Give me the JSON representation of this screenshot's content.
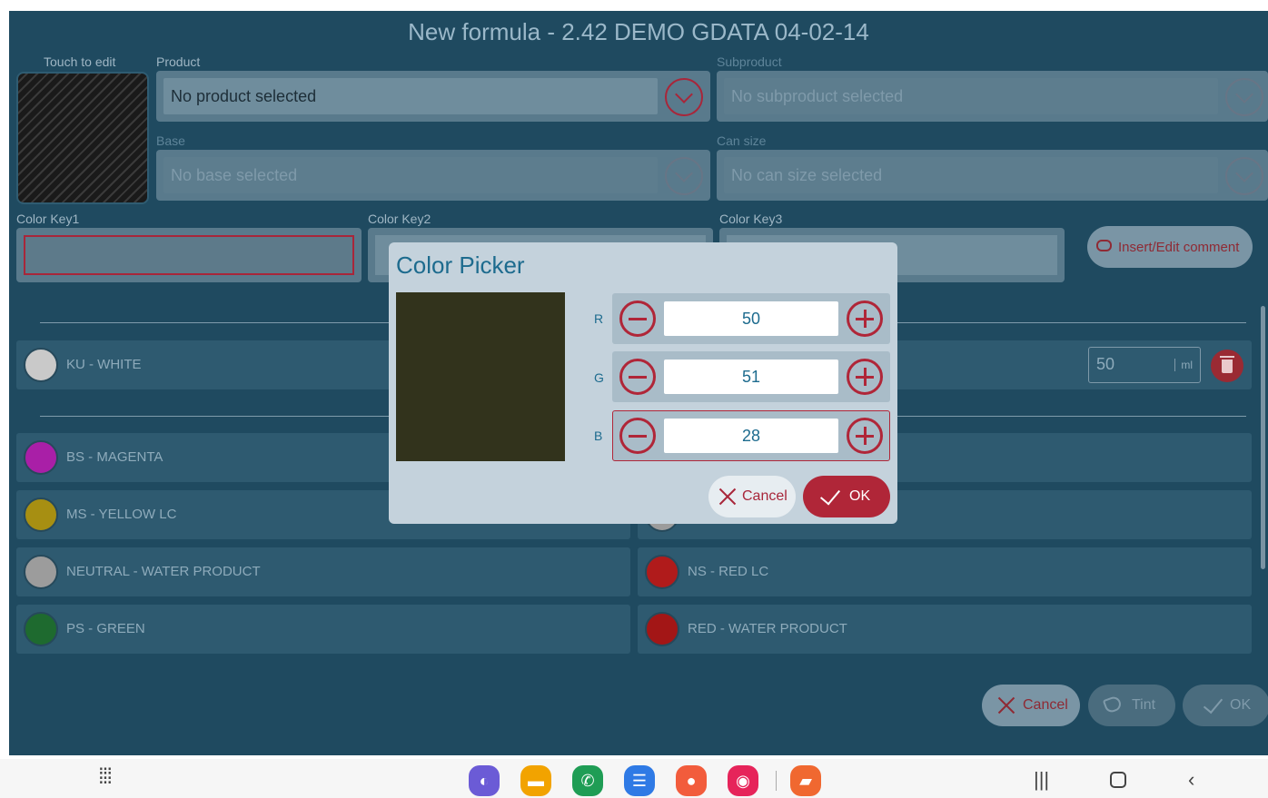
{
  "header": {
    "title": "New formula - 2.42  DEMO GDATA 04-02-14"
  },
  "swatch": {
    "label": "Touch to edit"
  },
  "fields": {
    "product": {
      "label": "Product",
      "value": "No product selected"
    },
    "subproduct": {
      "label": "Subproduct",
      "value": "No subproduct selected"
    },
    "base": {
      "label": "Base",
      "value": "No base selected"
    },
    "can_size": {
      "label": "Can size",
      "value": "No can size selected"
    }
  },
  "color_keys": {
    "key1": "Color Key1",
    "key2": "Color Key2",
    "key3": "Color Key3"
  },
  "comment_button": "Insert/Edit comment",
  "colorants": [
    {
      "name": "KU - WHITE",
      "color": "#c9c9c9"
    },
    {
      "name": "BS - MAGENTA",
      "color": "#a91fa7"
    },
    {
      "name": "MS - YELLOW LC",
      "color": "#a78f12"
    },
    {
      "name": "NEUTRAL - WATER PRODUCT",
      "color": "#9c9c9c"
    },
    {
      "name": "PS - GREEN",
      "color": "#1e6a2f"
    },
    {
      "name": "NS - RED LC",
      "color": "#b01b1b"
    },
    {
      "name": "RED - WATER PRODUCT",
      "color": "#a31616"
    }
  ],
  "quantity": {
    "value": "50",
    "unit": "ml"
  },
  "footer_buttons": {
    "cancel": "Cancel",
    "tint": "Tint",
    "ok": "OK"
  },
  "color_picker": {
    "title": "Color Picker",
    "preview_color": "#32331c",
    "channels": [
      {
        "label": "R",
        "value": "50"
      },
      {
        "label": "G",
        "value": "51"
      },
      {
        "label": "B",
        "value": "28"
      }
    ],
    "cancel": "Cancel",
    "ok": "OK"
  },
  "nav": {
    "apps": [
      {
        "icon": "internet-icon",
        "color": "#6b5bd6"
      },
      {
        "icon": "folder-icon",
        "color": "#f2a300"
      },
      {
        "icon": "phone-icon",
        "color": "#1f9d55"
      },
      {
        "icon": "messages-icon",
        "color": "#2f7ae5"
      },
      {
        "icon": "contacts-icon",
        "color": "#f25c3c"
      },
      {
        "icon": "screen-recorder-icon",
        "color": "#e6245a"
      },
      {
        "icon": "notes-icon",
        "color": "#f06830"
      }
    ]
  }
}
